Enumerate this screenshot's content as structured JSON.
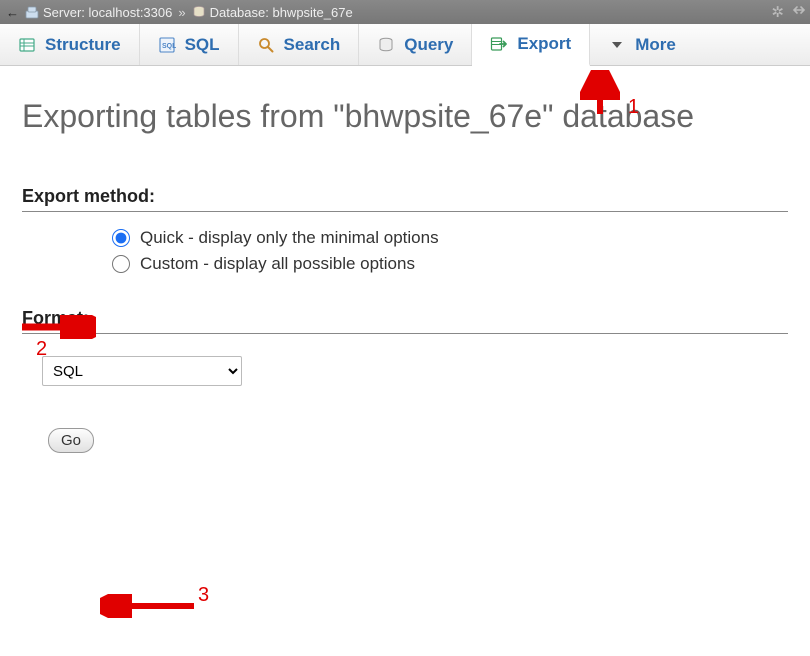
{
  "breadcrumb": {
    "server_label": "Server: localhost:3306",
    "db_label": "Database: bhwpsite_67e"
  },
  "tabs": [
    {
      "label": "Structure",
      "icon": "structure-icon",
      "active": false
    },
    {
      "label": "SQL",
      "icon": "sql-icon",
      "active": false
    },
    {
      "label": "Search",
      "icon": "search-icon",
      "active": false
    },
    {
      "label": "Query",
      "icon": "query-icon",
      "active": false
    },
    {
      "label": "Export",
      "icon": "export-icon",
      "active": true
    },
    {
      "label": "More",
      "icon": "more-icon",
      "active": false
    }
  ],
  "page": {
    "title": "Exporting tables from \"bhwpsite_67e\" database"
  },
  "export_method": {
    "section_title": "Export method:",
    "options": [
      {
        "label": "Quick - display only the minimal options",
        "value": "quick",
        "checked": true
      },
      {
        "label": "Custom - display all possible options",
        "value": "custom",
        "checked": false
      }
    ]
  },
  "format": {
    "section_title": "Format:",
    "selected": "SQL",
    "options": [
      "SQL"
    ]
  },
  "actions": {
    "go_label": "Go"
  },
  "annotations": {
    "n1": "1",
    "n2": "2",
    "n3": "3"
  },
  "icons": {
    "server-icon": "🖥",
    "database-icon": "🗄",
    "gear-icon": "⚙",
    "collapse-icon": "⤡"
  }
}
